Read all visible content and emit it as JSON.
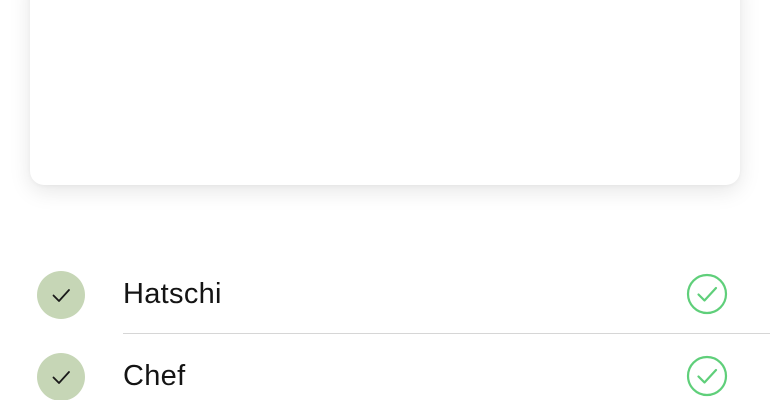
{
  "colors": {
    "avatar_bg": "#c6d6b6",
    "status_green": "#5fcf7a",
    "divider": "#d6d6d6"
  },
  "participants": [
    {
      "name": "Hatschi",
      "avatar_icon": "checkmark-icon",
      "status_icon": "check-circle-icon"
    },
    {
      "name": "Chef",
      "avatar_icon": "checkmark-icon",
      "status_icon": "check-circle-icon"
    }
  ]
}
